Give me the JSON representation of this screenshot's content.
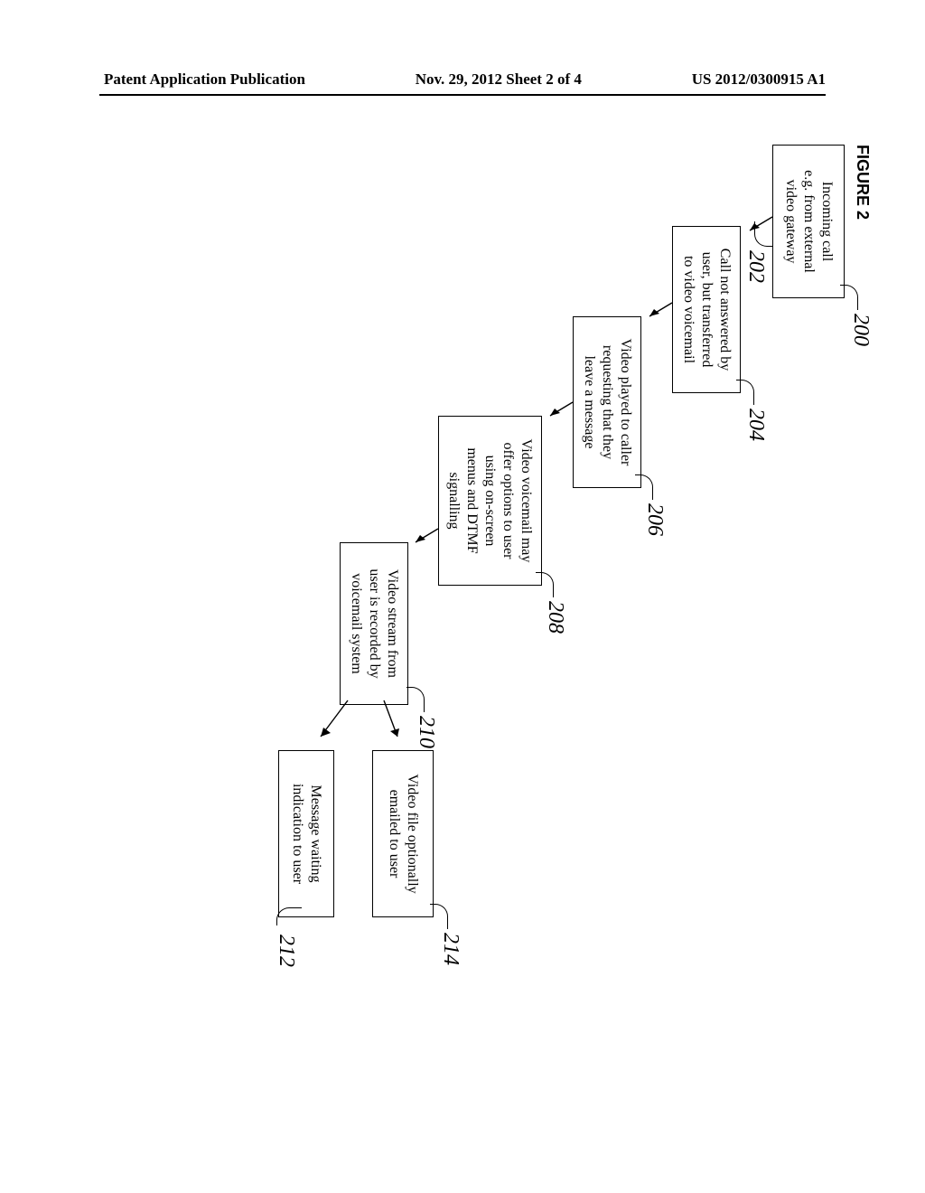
{
  "header": {
    "left": "Patent Application Publication",
    "center": "Nov. 29, 2012  Sheet 2 of 4",
    "right": "US 2012/0300915 A1"
  },
  "figure_label": "FIGURE 2",
  "boxes": {
    "b202": "Incoming call\ne.g. from external\nvideo gateway",
    "b204": "Call not answered by\nuser, but transferred\nto video voicemail",
    "b206": "Video played to caller\nrequesting that they\nleave a message",
    "b208": "Video voicemail may\noffer options to user\nusing on-screen\nmenus and DTMF\nsignalling",
    "b210": "Video stream from\nuser is recorded by\nvoicemail system",
    "b214": "Video file optionally\nemailed to user",
    "b212": "Message waiting\nindication to user"
  },
  "refs": {
    "r200": "200",
    "r202": "202",
    "r204": "204",
    "r206": "206",
    "r208": "208",
    "r210": "210",
    "r214": "214",
    "r212": "212"
  }
}
